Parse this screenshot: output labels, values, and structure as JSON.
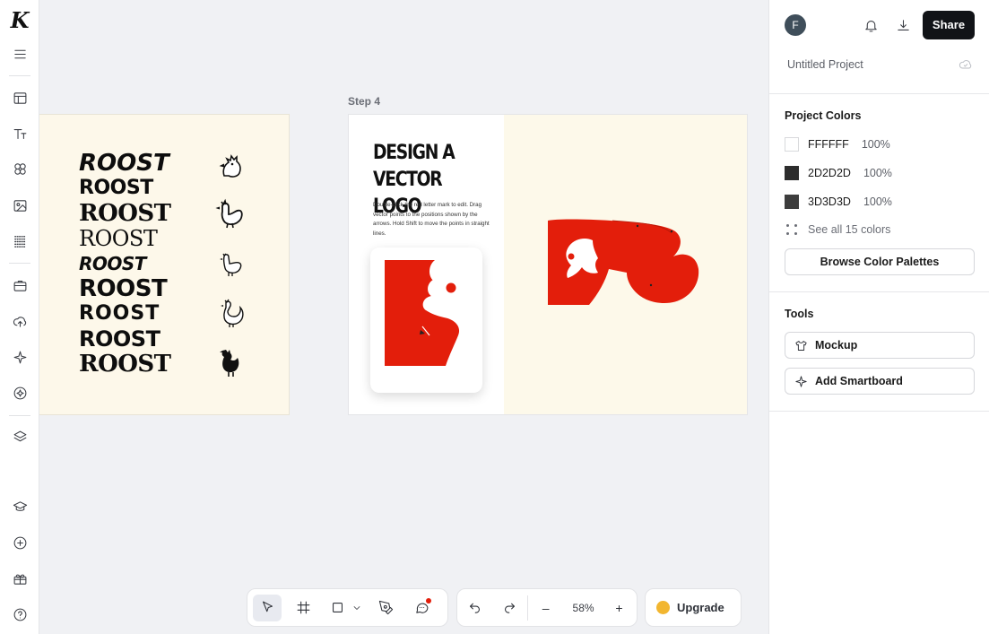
{
  "app": {
    "logo_letter": "K"
  },
  "rail": {
    "items": [
      {
        "icon": "menu-icon"
      },
      {
        "icon": "layout-icon"
      },
      {
        "icon": "text-icon"
      },
      {
        "icon": "elements-icon"
      },
      {
        "icon": "image-icon"
      },
      {
        "icon": "pattern-icon"
      },
      {
        "icon": "briefcase-icon"
      },
      {
        "icon": "upload-icon"
      },
      {
        "icon": "sparkle-icon"
      },
      {
        "icon": "ai-icon"
      },
      {
        "icon": "layers-icon"
      },
      {
        "icon": "learn-icon"
      },
      {
        "icon": "add-circle-icon"
      },
      {
        "icon": "gift-icon"
      },
      {
        "icon": "help-icon"
      }
    ]
  },
  "canvas": {
    "left_artboard": {
      "roost_words": [
        "ROOST",
        "ROOST",
        "ROOST",
        "ROOST",
        "ROOST",
        "ROOST",
        "ROOST",
        "ROOST",
        "ROOST"
      ]
    },
    "step_label": "Step 4",
    "right_artboard": {
      "title_line1": "DESIGN A",
      "title_line2": "VECTOR LOGO",
      "description": "Double-click the red letter mark to edit. Drag vector points to the positions shown by the arrows. Hold Shift to move the points in straight lines.",
      "accent": "#e31e0b",
      "cream": "#fdf9ea"
    }
  },
  "toolbar": {
    "tools": [
      "select-tool-icon",
      "frame-tool-icon",
      "shape-tool-icon",
      "pen-tool-icon",
      "comment-tool-icon"
    ],
    "zoom": "58%",
    "zoom_minus": "–",
    "zoom_plus": "+",
    "upgrade_label": "Upgrade"
  },
  "panel": {
    "avatar_initial": "F",
    "share_label": "Share",
    "project_name": "Untitled Project",
    "colors_title": "Project Colors",
    "colors": [
      {
        "hex": "FFFFFF",
        "swatch": "#FFFFFF",
        "opacity": "100%"
      },
      {
        "hex": "2D2D2D",
        "swatch": "#2D2D2D",
        "opacity": "100%"
      },
      {
        "hex": "3D3D3D",
        "swatch": "#3D3D3D",
        "opacity": "100%"
      }
    ],
    "see_all_label": "See all 15 colors",
    "browse_label": "Browse Color Palettes",
    "tools_title": "Tools",
    "mockup_label": "Mockup",
    "smartboard_label": "Add Smartboard"
  }
}
